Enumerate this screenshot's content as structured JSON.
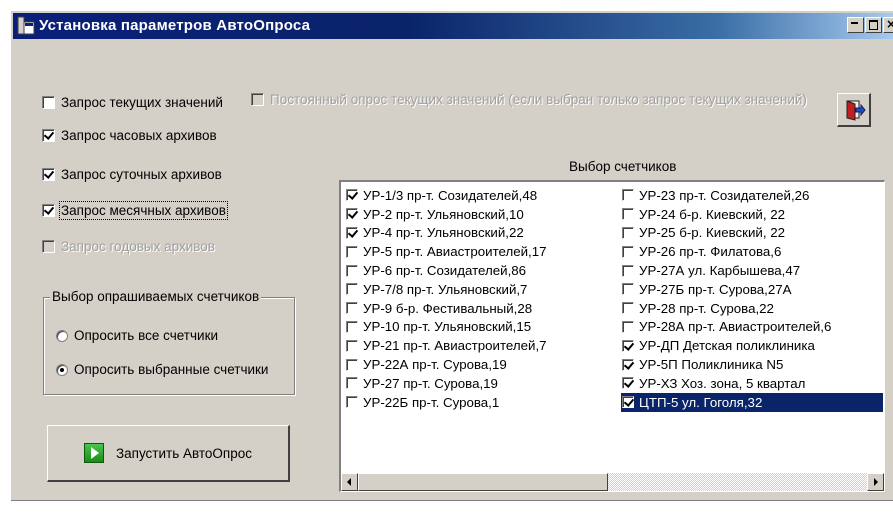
{
  "window": {
    "title": "Установка параметров АвтоОпроса"
  },
  "options": {
    "current_values": {
      "label": "Запрос текущих значений",
      "checked": false
    },
    "constant_poll": {
      "label": "Постоянный опрос текущих значений (если выбран только запрос текущих значений)",
      "checked": false,
      "enabled": false
    },
    "hourly": {
      "label": "Запрос часовых архивов",
      "checked": true
    },
    "daily": {
      "label": "Запрос суточных архивов",
      "checked": true
    },
    "monthly": {
      "label": "Запрос месячных архивов",
      "checked": true
    },
    "yearly": {
      "label": "Запрос годовых архивов",
      "checked": false,
      "enabled": false
    }
  },
  "group": {
    "legend": "Выбор опрашиваемых счетчиков",
    "poll_all": {
      "label": "Опросить все счетчики",
      "selected": false
    },
    "poll_selected": {
      "label": "Опросить выбранные счетчики",
      "selected": true
    }
  },
  "run_button": {
    "label": "Запустить АвтоОпрос"
  },
  "meters": {
    "caption": "Выбор счетчиков",
    "column1": [
      {
        "label": "УР-1/3 пр-т. Созидателей,48",
        "checked": true
      },
      {
        "label": "УР-2 пр-т. Ульяновский,10",
        "checked": true
      },
      {
        "label": "УР-4 пр-т. Ульяновский,22",
        "checked": true
      },
      {
        "label": "УР-5 пр-т. Авиастроителей,17",
        "checked": false
      },
      {
        "label": "УР-6 пр-т. Созидателей,86",
        "checked": false
      },
      {
        "label": "УР-7/8 пр-т. Ульяновский,7",
        "checked": false
      },
      {
        "label": "УР-9 б-р. Фестивальный,28",
        "checked": false
      },
      {
        "label": "УР-10 пр-т. Ульяновский,15",
        "checked": false
      },
      {
        "label": "УР-21 пр-т. Авиастроителей,7",
        "checked": false
      },
      {
        "label": "УР-22А пр-т. Сурова,19",
        "checked": false
      },
      {
        "label": "УР-27 пр-т. Сурова,19",
        "checked": false
      },
      {
        "label": "УР-22Б пр-т. Сурова,1",
        "checked": false
      }
    ],
    "column2": [
      {
        "label": "УР-23 пр-т. Созидателей,26",
        "checked": false
      },
      {
        "label": "УР-24 б-р. Киевский, 22",
        "checked": false
      },
      {
        "label": "УР-25 б-р. Киевский, 22",
        "checked": false
      },
      {
        "label": "УР-26 пр-т. Филатова,6",
        "checked": false
      },
      {
        "label": "УР-27А ул. Карбышева,47",
        "checked": false
      },
      {
        "label": "УР-27Б пр-т. Сурова,27А",
        "checked": false
      },
      {
        "label": "УР-28 пр-т. Сурова,22",
        "checked": false
      },
      {
        "label": "УР-28А пр-т. Авиастроителей,6",
        "checked": false
      },
      {
        "label": "УР-ДП Детская поликлиника",
        "checked": true
      },
      {
        "label": "УР-5П Поликлиника N5",
        "checked": true
      },
      {
        "label": "УР-ХЗ Хоз. зона, 5 квартал",
        "checked": true
      },
      {
        "label": "ЦТП-5 ул. Гоголя,32",
        "checked": true,
        "selected": true
      }
    ]
  },
  "icons": {
    "title": "app-window-icon",
    "exit": "exit-door-icon",
    "run": "play-icon"
  }
}
